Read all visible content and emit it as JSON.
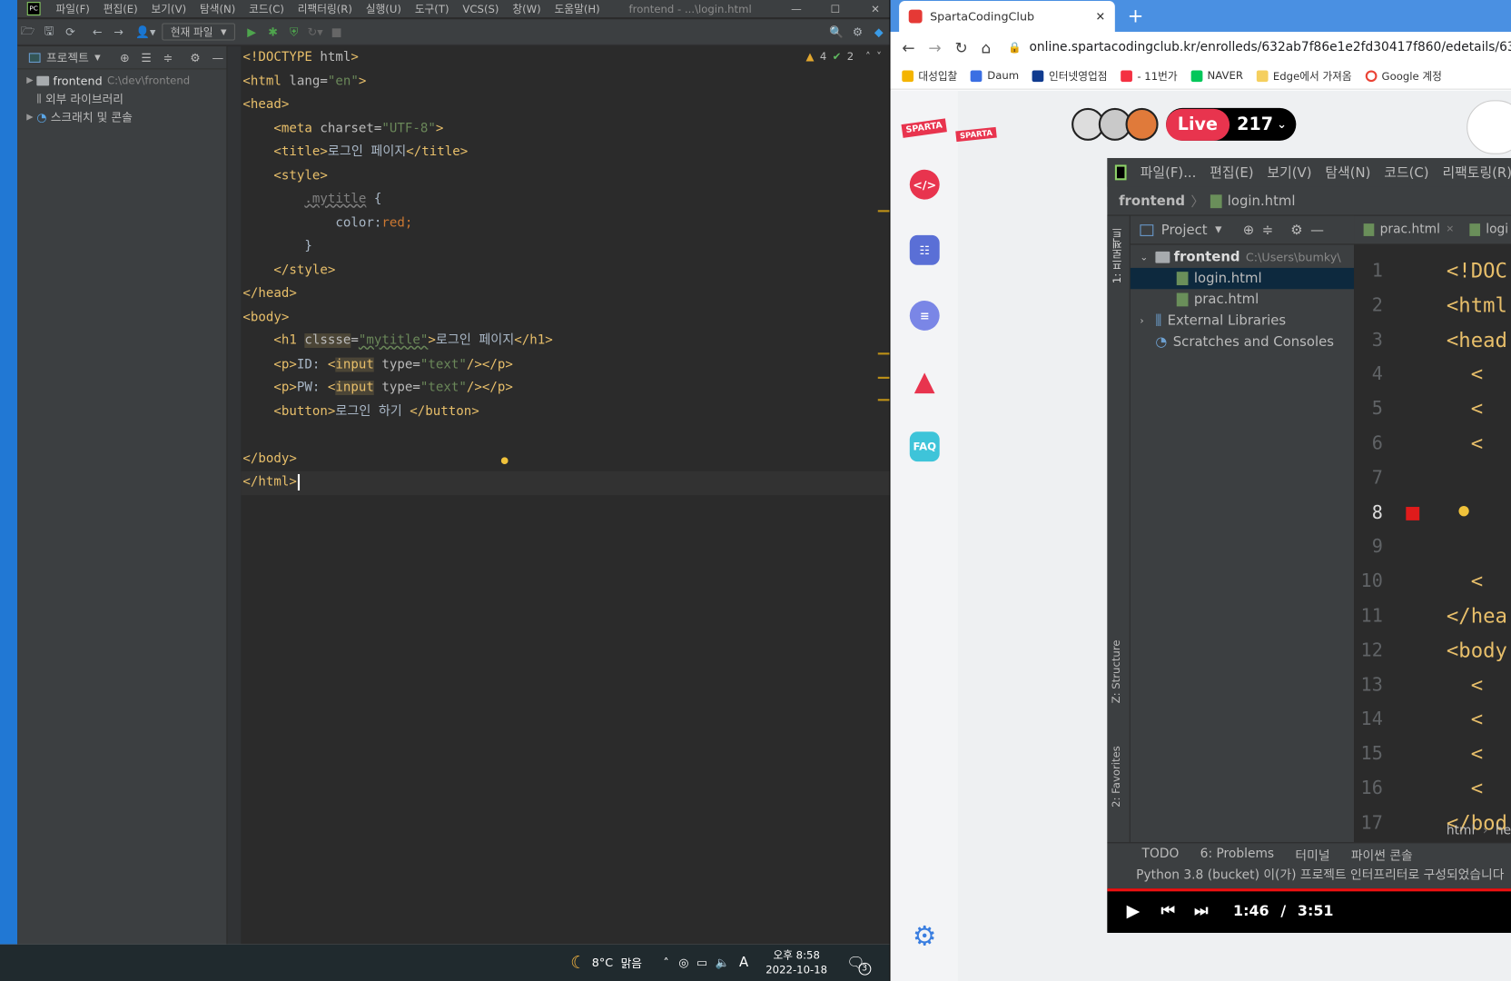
{
  "ide": {
    "menu": [
      "파일(F)",
      "편집(E)",
      "보기(V)",
      "탐색(N)",
      "코드(C)",
      "리팩터링(R)",
      "실행(U)",
      "도구(T)",
      "VCS(S)",
      "창(W)",
      "도움말(H)"
    ],
    "window_title": "frontend - ...\\login.html",
    "run_config": "현재 파일",
    "project_label": "프로젝트",
    "tree": {
      "root": "frontend",
      "root_path": "C:\\dev\\frontend",
      "libs": "외부 라이브러리",
      "scratches": "스크래치 및 콘솔"
    },
    "inspections": {
      "warnings": "4",
      "ok": "2"
    },
    "code": [
      "<!DOCTYPE html>",
      "<html lang=\"en\">",
      "<head>",
      "    <meta charset=\"UTF-8\">",
      "    <title>로그인 페이지</title>",
      "    <style>",
      "        .mytitle {",
      "            color:red;",
      "        }",
      "    </style>",
      "</head>",
      "<body>",
      "    <h1 clssse=\"mytitle\">로그인 페이지</h1>",
      "    <p>ID: <input type=\"text\"/></p>",
      "    <p>PW: <input type=\"text\"/></p>",
      "    <button>로그인 하기 </button>",
      "",
      "</body>",
      "</html>"
    ]
  },
  "taskbar": {
    "weather": "8°C",
    "weather_desc": "맑음",
    "ime": "A",
    "time": "오후 8:58",
    "date": "2022-10-18",
    "notif": "3"
  },
  "browser": {
    "tab_title": "SpartaCodingClub",
    "url": "online.spartacodingclub.kr/enrolleds/632ab7f86e1e2fd30417f860/edetails/632ab",
    "bookmarks": [
      "대성입찰",
      "Daum",
      "인터넷영업점",
      "- 11번가",
      "NAVER",
      "Edge에서 가져옴",
      "Google 계정"
    ],
    "live_label": "Live",
    "live_count": "217",
    "sidebar_badge": "SPARTA",
    "faq": "FAQ"
  },
  "video": {
    "menu": [
      "파일(F)...",
      "편집(E)",
      "보기(V)",
      "탐색(N)",
      "코드(C)",
      "리팩토링(R)"
    ],
    "breadcrumb": [
      "frontend",
      "login.html"
    ],
    "tabs": [
      "prac.html",
      "logi"
    ],
    "project_label": "Project",
    "tree": {
      "root": "frontend",
      "root_path": "C:\\Users\\bumky\\",
      "files": [
        "login.html",
        "prac.html"
      ],
      "libs": "External Libraries",
      "scratches": "Scratches and Consoles"
    },
    "line_numbers": [
      "1",
      "2",
      "3",
      "4",
      "5",
      "6",
      "7",
      "8",
      "9",
      "10",
      "11",
      "12",
      "13",
      "14",
      "15",
      "16",
      "17"
    ],
    "lines": [
      "<!DOC",
      "<html",
      "<head",
      "  <",
      "  <",
      "  <",
      "",
      "",
      "",
      "  <",
      "</hea",
      "<body",
      "  <",
      "  <",
      "  <",
      "  <",
      "</bod"
    ],
    "side_labels": {
      "project": "1: 프로젝트",
      "structure": "Z: Structure",
      "favorites": "2: Favorites"
    },
    "crumbs": [
      "html",
      "he"
    ],
    "bottom_tabs": [
      "TODO",
      "6: Problems",
      "터미널",
      "파이썬 콘솔"
    ],
    "status": "Python 3.8 (bucket) 이(가) 프로젝트 인터프리터로 구성되었습니다",
    "time_current": "1:46",
    "time_sep": "/",
    "time_total": "3:51"
  }
}
